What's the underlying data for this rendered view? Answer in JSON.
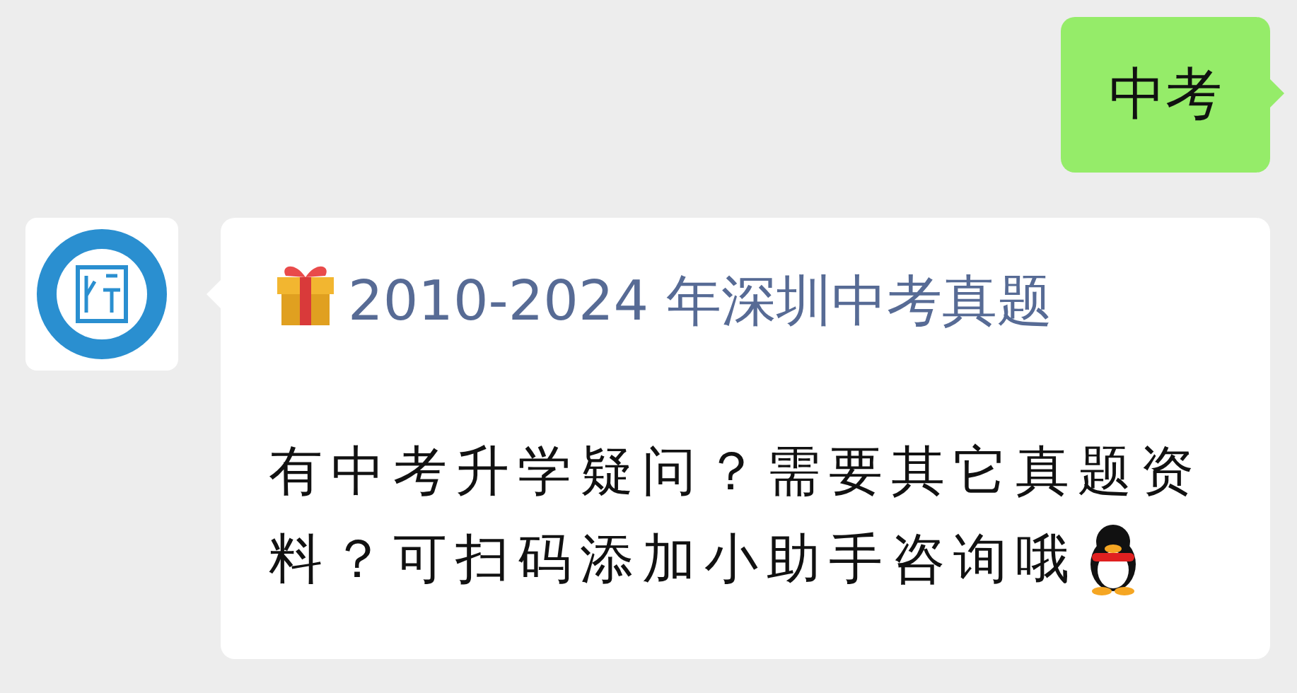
{
  "messages": [
    {
      "kind": "sent",
      "text": "中考"
    },
    {
      "kind": "received",
      "title": "2010-2024 年深圳中考真题",
      "body_lines": [
        "有中考升学疑问？需要其它真题资",
        "料？可扫码添加小助手咨询哦"
      ]
    }
  ]
}
